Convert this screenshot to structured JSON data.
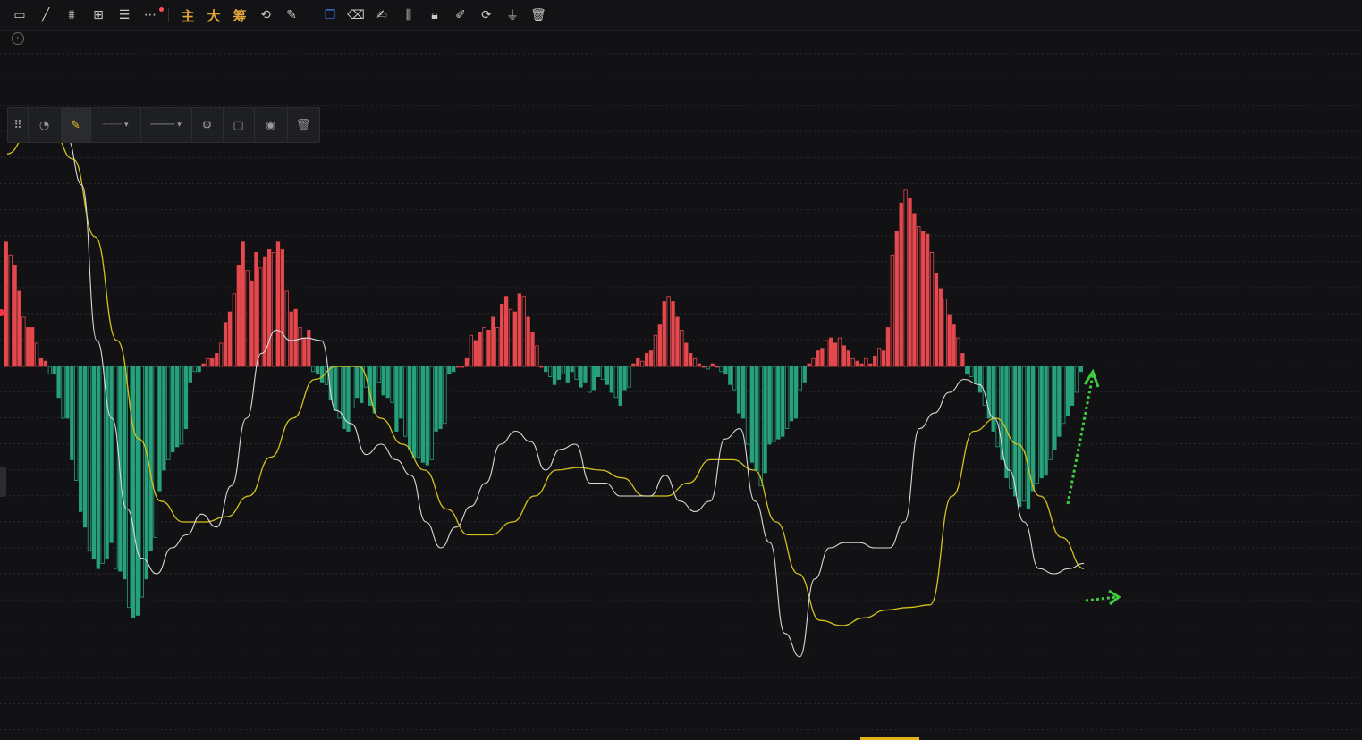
{
  "toolbar": {
    "buttons": [
      {
        "name": "rectangle-icon",
        "glyph": "▭"
      },
      {
        "name": "line-icon",
        "glyph": "╱"
      },
      {
        "name": "ruler-icon",
        "glyph": "⩩"
      },
      {
        "name": "add-frame-icon",
        "glyph": "⊞"
      },
      {
        "name": "menu-lines-icon",
        "glyph": "☰"
      },
      {
        "name": "more-icon",
        "glyph": "⋯"
      },
      {
        "name": "main-force-button",
        "glyph": "主"
      },
      {
        "name": "large-order-button",
        "glyph": "大"
      },
      {
        "name": "chip-distribution-button",
        "glyph": "筹"
      },
      {
        "name": "sync-icon",
        "glyph": "⟲"
      },
      {
        "name": "pen-line-icon",
        "glyph": "✎"
      },
      {
        "name": "copy-icon",
        "glyph": "❐"
      },
      {
        "name": "eraser-icon",
        "glyph": "⌫"
      },
      {
        "name": "brush-icon",
        "glyph": "✍"
      },
      {
        "name": "candles-icon",
        "glyph": "⫼"
      },
      {
        "name": "lock-icon",
        "glyph": "🔒︎"
      },
      {
        "name": "note-icon",
        "glyph": "✐"
      },
      {
        "name": "magnet-icon",
        "glyph": "⟳"
      },
      {
        "name": "filter-icon",
        "glyph": "⏚"
      },
      {
        "name": "trash-icon",
        "glyph": "🗑︎"
      }
    ]
  },
  "float_toolbar": {
    "items": [
      {
        "name": "drag-handle-icon",
        "glyph": "⠿"
      },
      {
        "name": "template-icon",
        "glyph": "◔"
      },
      {
        "name": "highlight-pen-icon",
        "glyph": "✎"
      },
      {
        "name": "dotted-line-style-dropdown",
        "glyph": "┈┈┈┈ ▾"
      },
      {
        "name": "solid-line-style-dropdown",
        "glyph": "───── ▾"
      },
      {
        "name": "settings-icon",
        "glyph": "⚙"
      },
      {
        "name": "lock-icon",
        "glyph": "▢"
      },
      {
        "name": "visibility-icon",
        "glyph": "◉"
      },
      {
        "name": "delete-icon",
        "glyph": "🗑︎"
      }
    ]
  },
  "colors": {
    "background": "#121214",
    "grid": "#2a2a2e",
    "hist_up": "#e5484d",
    "hist_down": "#26a17b",
    "dif": "#d9d9d9",
    "dea": "#d4c21c",
    "annotation_arrow": "#3fcc3f"
  },
  "chart_data": {
    "type": "bar",
    "title": "",
    "xlabel": "",
    "ylabel": "",
    "ylim": [
      -1.0,
      1.0
    ],
    "legend": "none",
    "grid": true,
    "histogram": [
      0.48,
      0.43,
      0.39,
      0.29,
      0.19,
      0.15,
      0.15,
      0.09,
      0.03,
      0.02,
      -0.03,
      -0.03,
      -0.12,
      -0.2,
      -0.2,
      -0.36,
      -0.44,
      -0.56,
      -0.62,
      -0.71,
      -0.74,
      -0.78,
      -0.76,
      -0.74,
      -0.68,
      -0.78,
      -0.79,
      -0.82,
      -0.93,
      -0.97,
      -0.96,
      -0.89,
      -0.82,
      -0.71,
      -0.66,
      -0.48,
      -0.4,
      -0.36,
      -0.33,
      -0.31,
      -0.3,
      -0.24,
      -0.06,
      -0.02,
      -0.02,
      0.01,
      0.03,
      0.03,
      0.05,
      0.09,
      0.17,
      0.21,
      0.28,
      0.39,
      0.48,
      0.37,
      0.33,
      0.44,
      0.38,
      0.42,
      0.45,
      0.44,
      0.48,
      0.45,
      0.29,
      0.21,
      0.22,
      0.15,
      0.11,
      0.14,
      -0.02,
      -0.03,
      -0.06,
      -0.07,
      -0.13,
      -0.17,
      -0.2,
      -0.24,
      -0.25,
      -0.16,
      -0.12,
      -0.14,
      -0.08,
      -0.15,
      -0.18,
      -0.06,
      -0.11,
      -0.12,
      -0.14,
      -0.25,
      -0.2,
      -0.27,
      -0.32,
      -0.35,
      -0.35,
      -0.37,
      -0.38,
      -0.36,
      -0.25,
      -0.24,
      -0.22,
      -0.03,
      -0.02,
      0.0,
      0.0,
      0.03,
      0.12,
      0.1,
      0.13,
      0.15,
      0.14,
      0.19,
      0.15,
      0.24,
      0.27,
      0.22,
      0.21,
      0.28,
      0.27,
      0.19,
      0.13,
      0.08,
      0.0,
      -0.02,
      -0.04,
      -0.07,
      -0.05,
      -0.03,
      -0.06,
      -0.02,
      -0.05,
      -0.08,
      -0.06,
      -0.1,
      -0.09,
      -0.04,
      -0.05,
      -0.07,
      -0.1,
      -0.12,
      -0.15,
      -0.09,
      -0.08,
      0.01,
      0.03,
      0.02,
      0.05,
      0.06,
      0.12,
      0.16,
      0.25,
      0.27,
      0.25,
      0.19,
      0.14,
      0.09,
      0.05,
      0.03,
      0.01,
      0.0,
      -0.01,
      0.01,
      0.0,
      -0.02,
      -0.03,
      -0.07,
      -0.09,
      -0.18,
      -0.2,
      -0.3,
      -0.37,
      -0.4,
      -0.46,
      -0.41,
      -0.3,
      -0.29,
      -0.28,
      -0.27,
      -0.24,
      -0.21,
      -0.2,
      -0.09,
      -0.06,
      0.01,
      0.03,
      0.06,
      0.07,
      0.1,
      0.11,
      0.09,
      0.11,
      0.08,
      0.06,
      0.03,
      0.02,
      0.01,
      0.03,
      0.01,
      0.04,
      0.07,
      0.06,
      0.15,
      0.43,
      0.52,
      0.63,
      0.68,
      0.65,
      0.59,
      0.54,
      0.52,
      0.51,
      0.44,
      0.36,
      0.3,
      0.26,
      0.2,
      0.16,
      0.11,
      0.05,
      -0.03,
      -0.04,
      -0.06,
      -0.1,
      -0.15,
      -0.2,
      -0.25,
      -0.31,
      -0.36,
      -0.43,
      -0.47,
      -0.5,
      -0.54,
      -0.52,
      -0.55,
      -0.48,
      -0.45,
      -0.43,
      -0.42,
      -0.36,
      -0.32,
      -0.27,
      -0.22,
      -0.19,
      -0.15,
      -0.1,
      -0.02
    ],
    "dif": [
      0.88,
      0.98,
      0.92,
      0.95,
      0.88,
      0.7,
      0.1,
      -0.2,
      -0.55,
      -0.74,
      -0.8,
      -0.7,
      -0.65,
      -0.57,
      -0.62,
      -0.46,
      -0.2,
      0.05,
      0.14,
      0.1,
      0.11,
      0.1,
      -0.17,
      -0.22,
      -0.34,
      -0.3,
      -0.36,
      -0.42,
      -0.6,
      -0.7,
      -0.62,
      -0.54,
      -0.45,
      -0.3,
      -0.25,
      -0.29,
      -0.4,
      -0.32,
      -0.3,
      -0.45,
      -0.45,
      -0.5,
      -0.5,
      -0.5,
      -0.42,
      -0.52,
      -0.56,
      -0.52,
      -0.28,
      -0.24,
      -0.52,
      -0.68,
      -1.03,
      -1.12,
      -0.82,
      -0.7,
      -0.68,
      -0.68,
      -0.7,
      -0.7,
      -0.6,
      -0.24,
      -0.18,
      -0.1,
      -0.05,
      -0.07,
      -0.2,
      -0.4,
      -0.6,
      -0.78,
      -0.8,
      -0.78,
      -0.76
    ],
    "dea": [
      0.82,
      0.9,
      0.92,
      0.8,
      0.5,
      0.1,
      -0.28,
      -0.52,
      -0.6,
      -0.6,
      -0.58,
      -0.5,
      -0.35,
      -0.2,
      -0.05,
      0.0,
      0.0,
      -0.2,
      -0.3,
      -0.4,
      -0.55,
      -0.65,
      -0.65,
      -0.6,
      -0.5,
      -0.4,
      -0.39,
      -0.4,
      -0.43,
      -0.5,
      -0.5,
      -0.45,
      -0.36,
      -0.36,
      -0.4,
      -0.6,
      -0.8,
      -0.98,
      -1.0,
      -0.97,
      -0.94,
      -0.93,
      -0.92,
      -0.5,
      -0.25,
      -0.2,
      -0.3,
      -0.5,
      -0.66,
      -0.78
    ]
  }
}
